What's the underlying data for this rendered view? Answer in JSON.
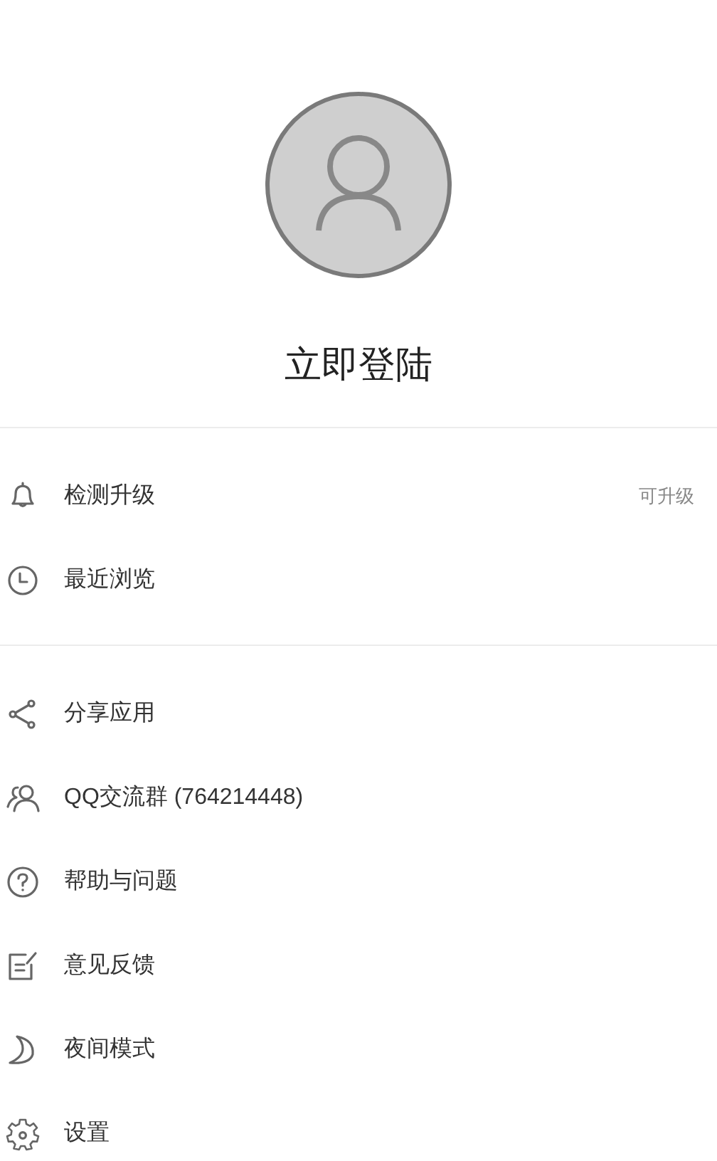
{
  "profile": {
    "login_label": "立即登陆"
  },
  "sections": [
    {
      "items": [
        {
          "label": "检测升级",
          "badge": "可升级"
        },
        {
          "label": "最近浏览"
        }
      ]
    },
    {
      "items": [
        {
          "label": "分享应用"
        },
        {
          "label": "QQ交流群 (764214448)"
        },
        {
          "label": "帮助与问题"
        },
        {
          "label": "意见反馈"
        },
        {
          "label": "夜间模式"
        },
        {
          "label": "设置"
        }
      ]
    }
  ]
}
